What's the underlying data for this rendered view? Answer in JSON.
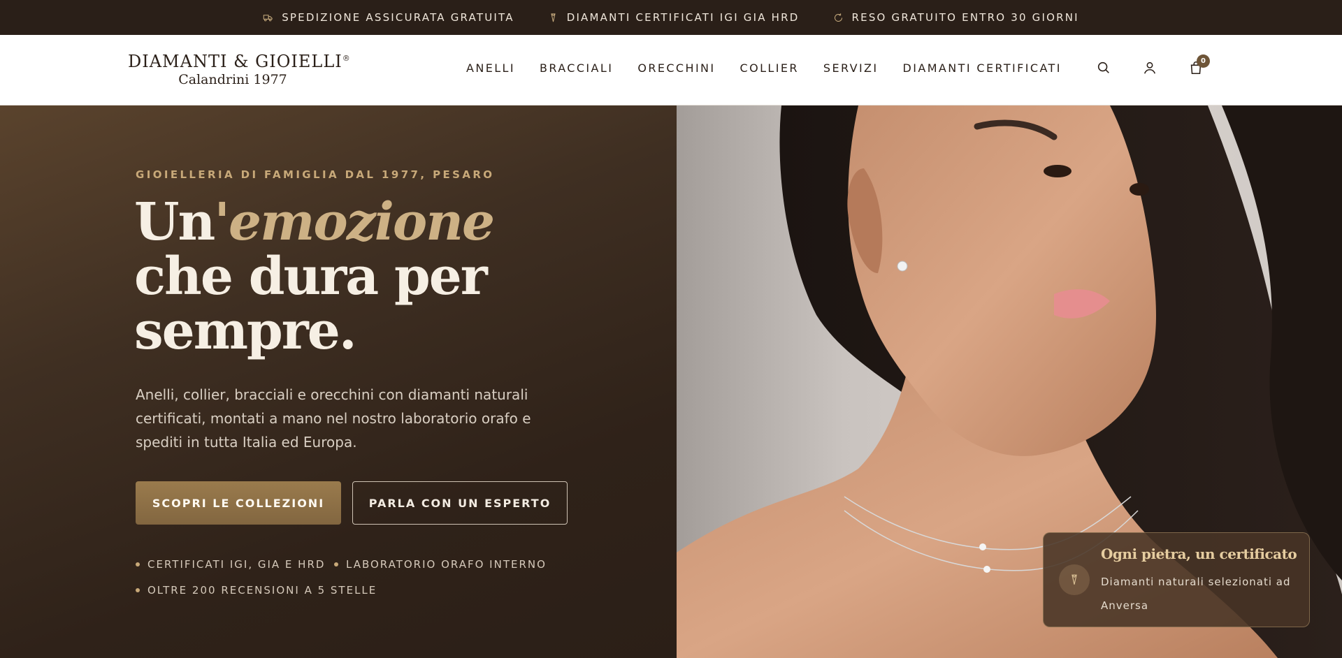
{
  "topbar": {
    "items": [
      {
        "icon": "truck-icon",
        "label": "SPEDIZIONE ASSICURATA GRATUITA"
      },
      {
        "icon": "diamond-icon",
        "label": "DIAMANTI CERTIFICATI IGI GIA HRD"
      },
      {
        "icon": "return-icon",
        "label": "RESO GRATUITO ENTRO 30 GIORNI"
      }
    ]
  },
  "header": {
    "logo_main": "DIAMANTI & GIOIELLI",
    "logo_mark": "®",
    "logo_sub": "Calandrini 1977",
    "nav": [
      "ANELLI",
      "BRACCIALI",
      "ORECCHINI",
      "COLLIER",
      "SERVIZI",
      "DIAMANTI CERTIFICATI"
    ],
    "icons": [
      "search-icon",
      "user-icon",
      "bag-icon"
    ],
    "cart_count": "0"
  },
  "hero": {
    "eyebrow": "GIOIELLERIA DI FAMIGLIA DAL 1977, PESARO",
    "headline_pre": "Un",
    "headline_em": "'emozione",
    "headline_line2": "che dura per",
    "headline_line3": "sempre.",
    "lead": "Anelli, collier, bracciali e orecchini con diamanti naturali certificati, montati a mano nel nostro laboratorio orafo e spediti in tutta Italia ed Europa.",
    "cta_primary": "SCOPRI LE COLLEZIONI",
    "cta_secondary": "PARLA CON UN ESPERTO",
    "features": [
      "CERTIFICATI IGI, GIA E HRD",
      "LABORATORIO ORAFO INTERNO",
      "OLTRE 200 RECENSIONI A 5 STELLE"
    ]
  },
  "cert_card": {
    "icon": "diamond-icon",
    "title": "Ogni pietra, un certificato",
    "text": "Diamanti naturali selezionati ad Anversa"
  },
  "colors": {
    "topbar_bg": "#2a1f18",
    "accent_gold": "#c8a979",
    "button_gold": "#8a6c45",
    "hero_text": "#f6efe4"
  }
}
